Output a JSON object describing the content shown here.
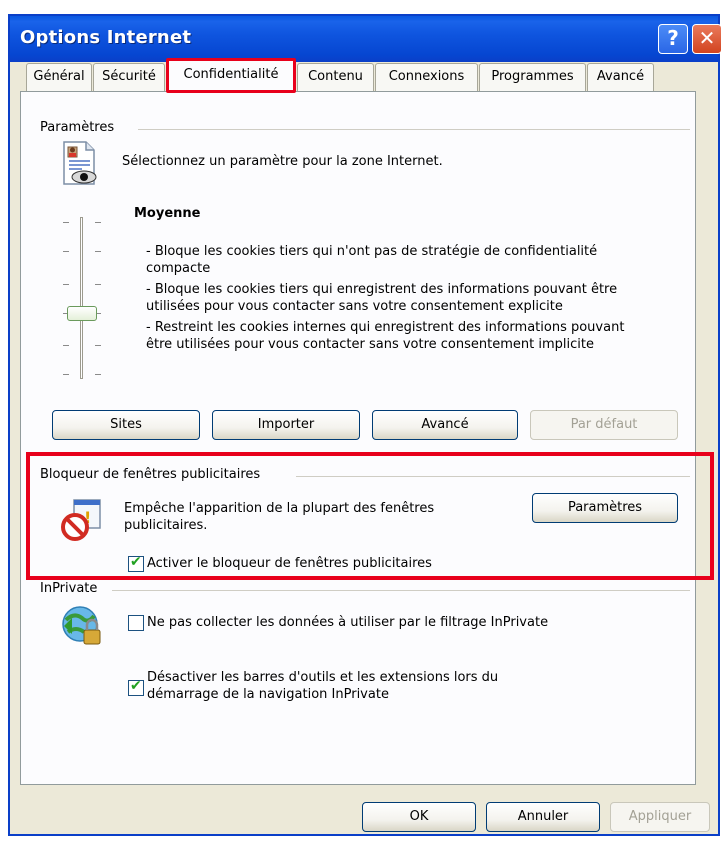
{
  "window": {
    "title": "Options Internet",
    "help_glyph": "?",
    "close_glyph": "✕"
  },
  "tabs": [
    {
      "label": "Général"
    },
    {
      "label": "Sécurité"
    },
    {
      "label": "Confidentialité",
      "active": true
    },
    {
      "label": "Contenu"
    },
    {
      "label": "Connexions"
    },
    {
      "label": "Programmes"
    },
    {
      "label": "Avancé"
    }
  ],
  "parametres": {
    "group_label": "Paramètres",
    "instruction": "Sélectionnez un paramètre pour la zone Internet.",
    "level": "Moyenne",
    "descriptions": [
      "- Bloque les cookies tiers qui n'ont pas de stratégie de confidentialité",
      "compacte",
      "- Bloque les cookies tiers qui enregistrent des informations pouvant être",
      "utilisées pour vous contacter sans votre consentement explicite",
      "- Restreint les cookies internes qui enregistrent des informations pouvant",
      "être utilisées pour vous contacter sans votre consentement implicite"
    ],
    "buttons": {
      "sites": "Sites",
      "importer": "Importer",
      "avance": "Avancé",
      "par_defaut": "Par défaut"
    }
  },
  "popup_blocker": {
    "group_label": "Bloqueur de fenêtres publicitaires",
    "description_line1": "Empêche l'apparition de la plupart des fenêtres",
    "description_line2": "publicitaires.",
    "settings_button": "Paramètres",
    "checkbox_label": "Activer le bloqueur de fenêtres publicitaires",
    "checkbox_checked": true
  },
  "inprivate": {
    "group_label": "InPrivate",
    "filter_checkbox_label": "Ne pas collecter les données à utiliser par le filtrage InPrivate",
    "filter_checked": false,
    "toolbars_label_line1": "Désactiver les barres d'outils et les extensions lors du",
    "toolbars_label_line2": "démarrage de la navigation InPrivate",
    "toolbars_checked": true
  },
  "footer": {
    "ok": "OK",
    "annuler": "Annuler",
    "appliquer": "Appliquer"
  },
  "colors": {
    "titlebar": "#0a58e0",
    "highlight_red": "#e8001b",
    "dialog_bg": "#ece9d8"
  }
}
